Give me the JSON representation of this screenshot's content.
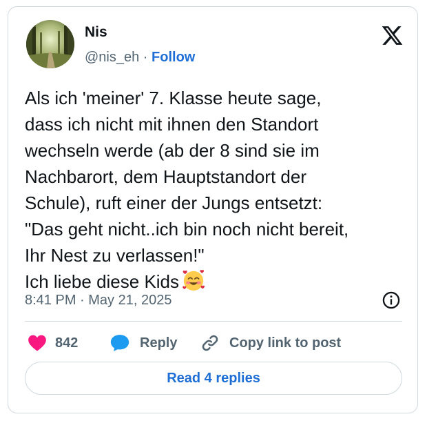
{
  "author": {
    "name": "Nis",
    "handle": "@nis_eh",
    "separator": " · ",
    "follow_label": "Follow"
  },
  "tweet": {
    "text": "Als ich 'meiner' 7. Klasse heute sage,\ndass ich nicht mit ihnen den Standort\nwechseln werde (ab der 8 sind sie im\nNachbarort, dem Hauptstandort der\nSchule), ruft einer der Jungs entsetzt:\n\"Das geht nicht..ich bin noch nicht bereit,\nIhr Nest zu verlassen!\"\nIch liebe diese Kids",
    "emoji": "smiling-face-with-hearts",
    "timestamp": "8:41 PM · May 21, 2025"
  },
  "actions": {
    "like_count": "842",
    "reply_label": "Reply",
    "copy_link_label": "Copy link to post"
  },
  "read_replies_label": "Read 4 replies",
  "colors": {
    "accent": "#1d6fd6",
    "like": "#f91880",
    "reply": "#1d9bf0",
    "muted": "#536471",
    "border": "#cfd9de"
  },
  "icons": {
    "brand": "x-logo-icon",
    "info": "info-icon",
    "like": "heart-icon",
    "reply": "speech-bubble-icon",
    "copy": "link-icon"
  }
}
